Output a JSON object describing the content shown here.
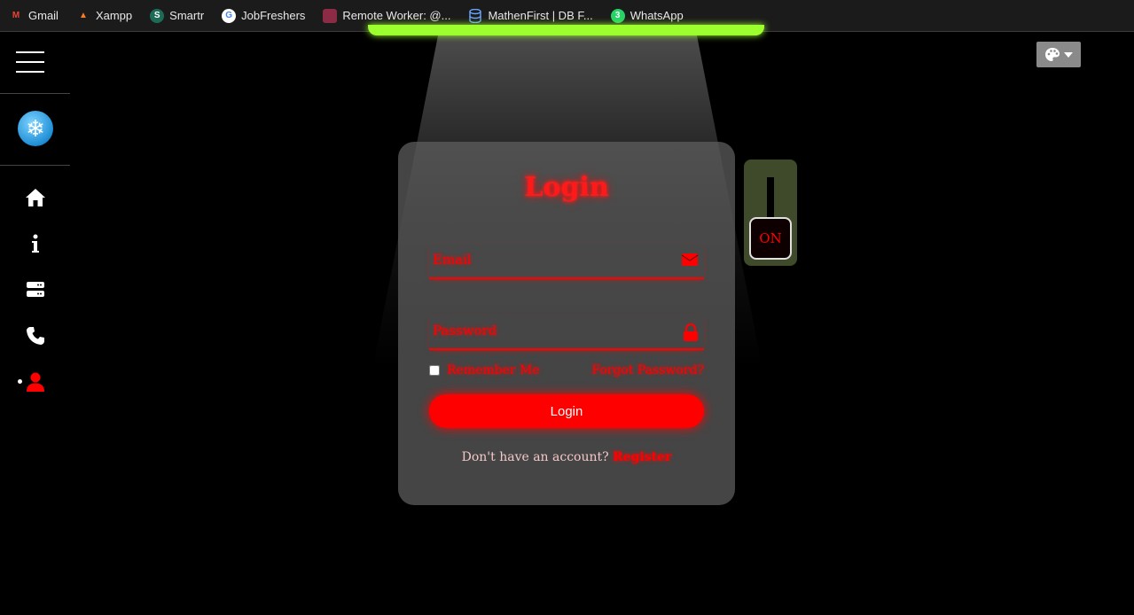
{
  "bookmarks": [
    {
      "label": "Gmail",
      "icon": "gmail-icon"
    },
    {
      "label": "Xampp",
      "icon": "xampp-icon"
    },
    {
      "label": "Smartr",
      "icon": "smartr-icon"
    },
    {
      "label": "JobFreshers",
      "icon": "google-icon"
    },
    {
      "label": "Remote Worker: @...",
      "icon": "remote-worker-icon"
    },
    {
      "label": "MathenFirst | DB F...",
      "icon": "database-icon"
    },
    {
      "label": "WhatsApp",
      "icon": "whatsapp-icon"
    }
  ],
  "sidebar": {
    "items": [
      {
        "name": "home",
        "icon": "home-icon"
      },
      {
        "name": "about",
        "icon": "info-icon"
      },
      {
        "name": "services",
        "icon": "server-icon"
      },
      {
        "name": "contact",
        "icon": "phone-icon"
      },
      {
        "name": "account",
        "icon": "user-icon",
        "active": true
      }
    ]
  },
  "login": {
    "title": "Login",
    "email_placeholder": "Email",
    "password_placeholder": "Password",
    "remember_label": "Remember Me",
    "forgot_label": "Forgot Password?",
    "submit_label": "Login",
    "register_prompt": "Don't have an account?",
    "register_link": "Register"
  },
  "light_switch": {
    "label": "ON"
  },
  "colors": {
    "accent": "#ff0000",
    "lamp": "#9cff2e",
    "card": "#5f5f5f",
    "background": "#000000"
  }
}
